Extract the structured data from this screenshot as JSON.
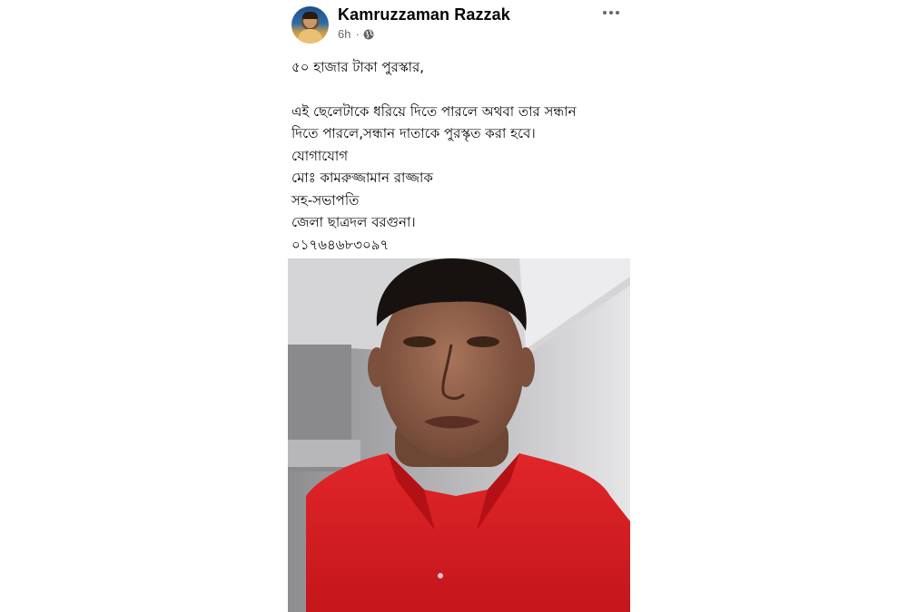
{
  "post": {
    "author": "Kamruzzaman Razzak",
    "time": "6h",
    "separator": "·",
    "privacy_icon": "globe-icon",
    "menu_icon": "more-options-icon",
    "text_lines": [
      "৫০ হাজার টাকা পুরস্কার,",
      "",
      "এই ছেলেটাকে ধরিয়ে দিতে পারলে অথবা তার সন্ধান",
      "দিতে পারলে,সন্ধান দাতাকে পুরস্কৃত করা হবে।",
      "যোগাযোগ",
      "মোঃ কামরুজ্জামান রাজ্জাক",
      "সহ-সভাপতি",
      "জেলা ছাত্রদল বরগুনা।",
      "০১৭৬৪৬৮৩০৯৭"
    ]
  },
  "colors": {
    "name": "#050505",
    "meta": "#65676b",
    "shirt": "#d81e22",
    "wall": "#e4e4e6"
  }
}
